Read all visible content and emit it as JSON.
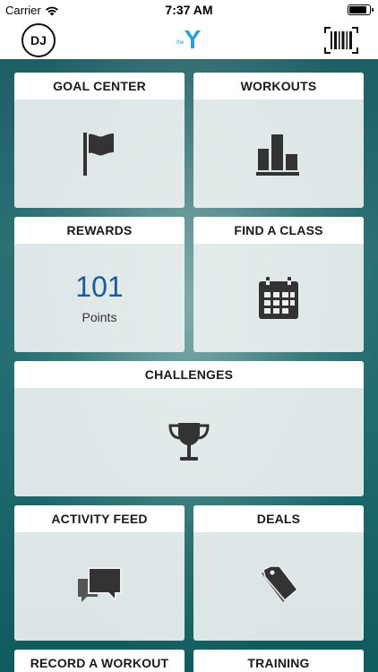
{
  "status_bar": {
    "carrier": "Carrier",
    "time": "7:37 AM"
  },
  "nav": {
    "avatar_initials": "DJ",
    "logo_text": "the"
  },
  "tiles": {
    "goal_center": {
      "label": "GOAL CENTER",
      "icon": "flag-icon"
    },
    "workouts": {
      "label": "WORKOUTS",
      "icon": "bar-chart-icon"
    },
    "rewards": {
      "label": "REWARDS",
      "points_value": "101",
      "points_label": "Points"
    },
    "find_a_class": {
      "label": "FIND A CLASS",
      "icon": "calendar-icon"
    },
    "challenges": {
      "label": "CHALLENGES",
      "icon": "trophy-icon"
    },
    "activity_feed": {
      "label": "ACTIVITY FEED",
      "icon": "chat-bubbles-icon"
    },
    "deals": {
      "label": "DEALS",
      "icon": "tags-icon"
    },
    "record_a_workout": {
      "label": "RECORD A WORKOUT"
    },
    "training": {
      "label": "TRAINING"
    }
  },
  "colors": {
    "accent": "#1a5aa0",
    "icon": "#333333",
    "tile_bg": "#ecf0f0",
    "header_bg": "#ffffff"
  }
}
